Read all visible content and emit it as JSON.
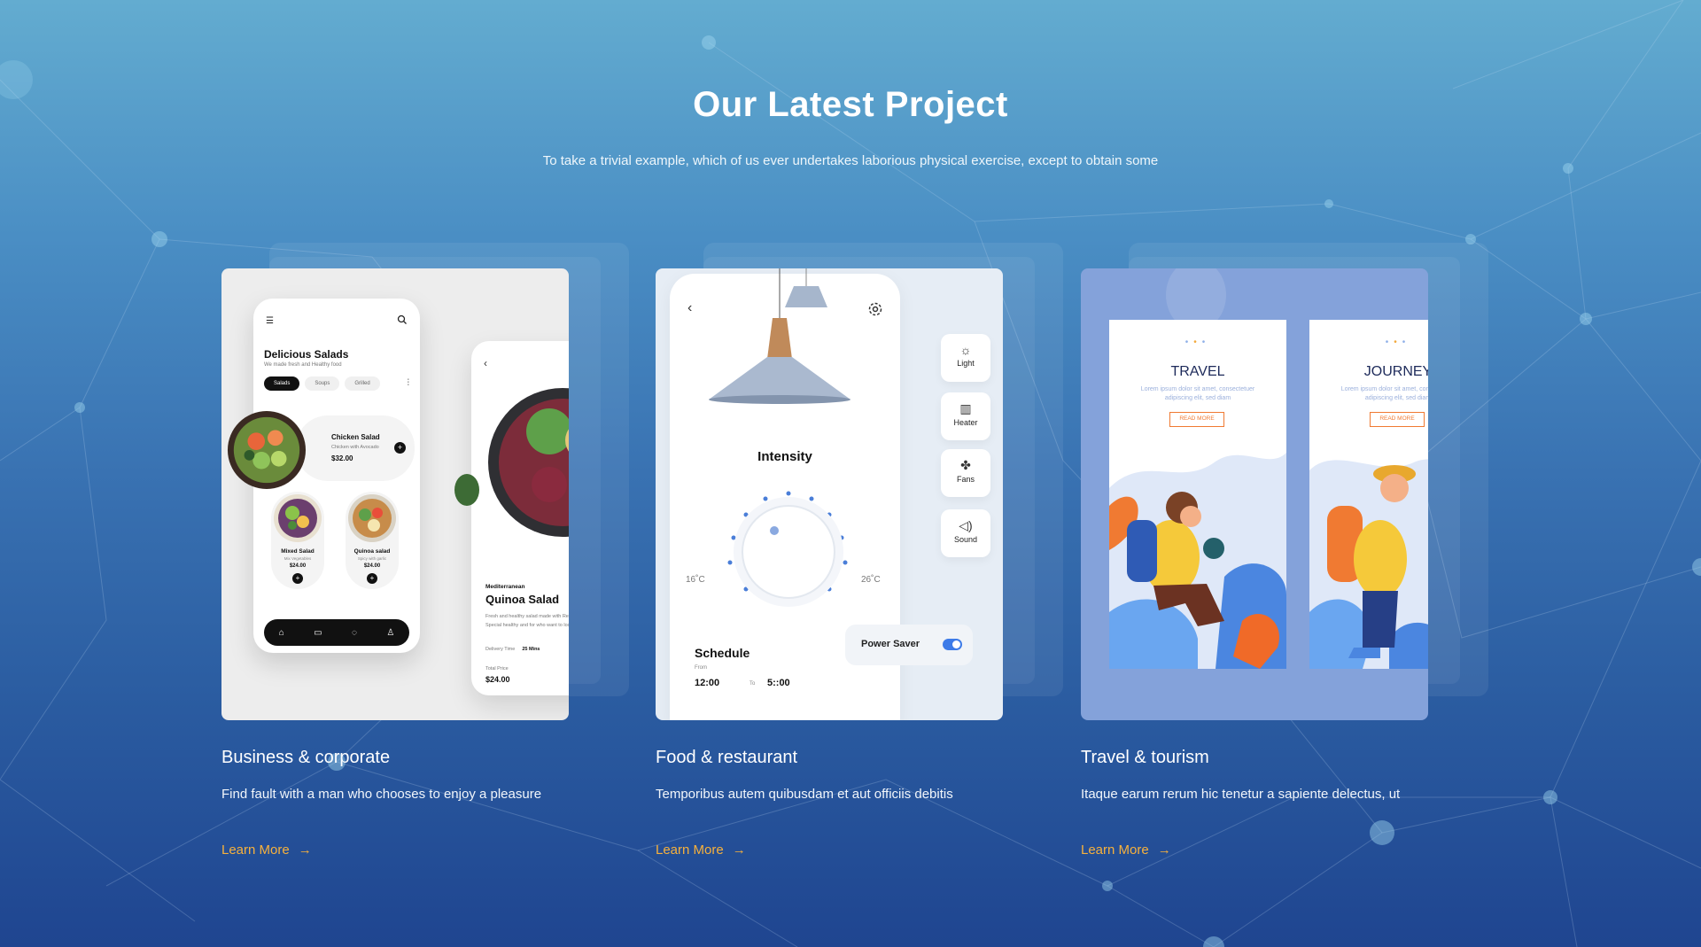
{
  "header": {
    "title": "Our Latest Project",
    "subtitle": "To take a trivial example, which of us ever undertakes laborious physical exercise, except to obtain some"
  },
  "colors": {
    "accent": "#f7b13c",
    "background_top": "#63acd0",
    "background_bottom": "#1f4590"
  },
  "projects": [
    {
      "title": "Business & corporate",
      "description": "Find fault with a man who chooses to enjoy a pleasure",
      "link": "Learn More",
      "link_icon": "arrow-right-icon",
      "mockup": {
        "app_title": "Delicious Salads",
        "app_subtitle": "We made fresh and Healthy food",
        "tabs": [
          "Salads",
          "Soups",
          "Grilled"
        ],
        "featured": {
          "name": "Chicken Salad",
          "desc": "Chicken with Avocado",
          "price": "$32.00"
        },
        "items": [
          {
            "name": "Mixed Salad",
            "desc": "Mix Vegetables",
            "price": "$24.00"
          },
          {
            "name": "Quinoa salad",
            "desc": "Spicy with garlic",
            "price": "$24.00"
          }
        ],
        "detail": {
          "category": "Mediterranean",
          "dish": "Quinoa Salad",
          "description": "Fresh and healthy salad made with Recipe, Special healthy and for who want to lose weight",
          "delivery_label": "Delivery Time",
          "delivery_value": "25 Mins",
          "total_label": "Total Price",
          "total": "$24.00"
        }
      }
    },
    {
      "title": "Food & restaurant",
      "description": "Temporibus autem quibusdam et aut officiis debitis",
      "link": "Learn More",
      "link_icon": "arrow-right-icon",
      "mockup": {
        "intensity": "Intensity",
        "min_temp": "16˚C",
        "max_temp": "26˚C",
        "controls": [
          {
            "label": "Light",
            "icon": "sun-icon"
          },
          {
            "label": "Heater",
            "icon": "heater-icon"
          },
          {
            "label": "Fans",
            "icon": "fan-icon"
          },
          {
            "label": "Sound",
            "icon": "speaker-icon"
          }
        ],
        "power_saver": "Power Saver",
        "power_saver_on": true,
        "schedule": "Schedule",
        "from_label": "From",
        "from_time": "12:00",
        "to_label": "To",
        "to_time": "5::00"
      }
    },
    {
      "title": "Travel & tourism",
      "description": "Itaque earum rerum hic tenetur a sapiente delectus, ut",
      "link": "Learn More",
      "link_icon": "arrow-right-icon",
      "mockup": {
        "cards": [
          {
            "title": "TRAVEL",
            "desc": "Lorem ipsum dolor sit amet, consectetuer adipiscing elit, sed diam",
            "button": "READ MORE"
          },
          {
            "title": "JOURNEY",
            "desc": "Lorem ipsum dolor sit amet, consectetuer adipiscing elit, sed diam",
            "button": "READ MORE"
          }
        ]
      }
    }
  ]
}
